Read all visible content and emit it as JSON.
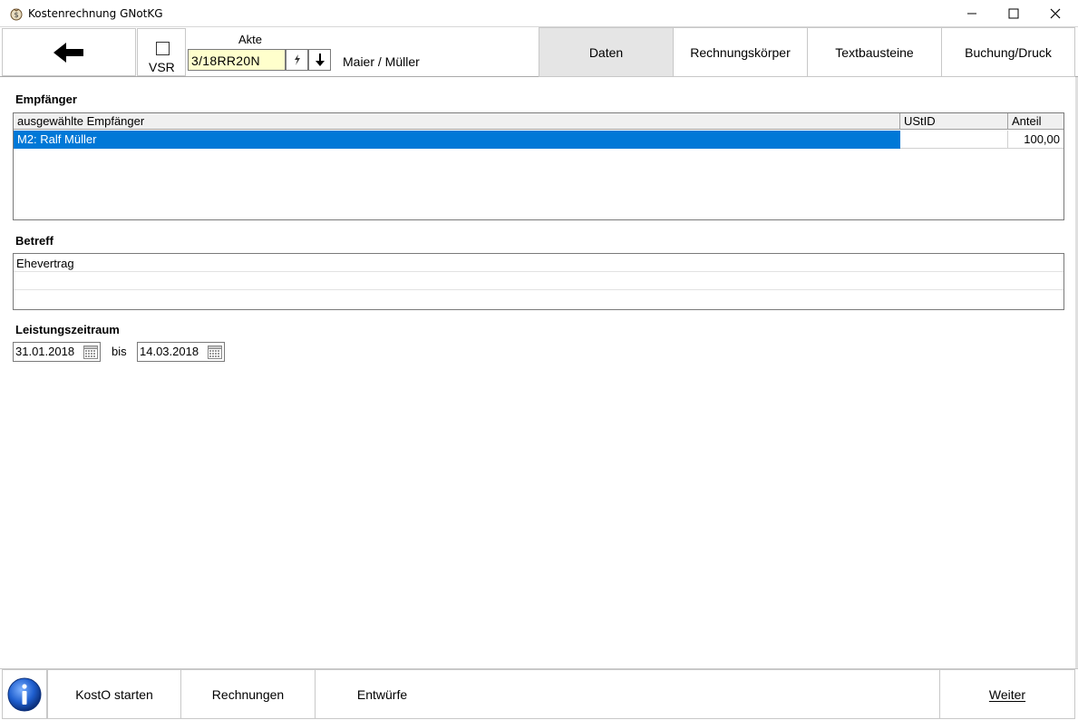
{
  "window": {
    "title": "Kostenrechnung GNotKG",
    "icon": "money-bag-icon"
  },
  "toolbar": {
    "back_icon": "arrow-left-icon",
    "vsr_label": "VSR",
    "vsr_checked": false,
    "akte_label": "Akte",
    "akte_value": "3/18RR20N",
    "party_text": "Maier / Müller",
    "tabs": [
      {
        "label": "Daten",
        "active": true
      },
      {
        "label": "Rechnungskörper",
        "active": false
      },
      {
        "label": "Textbausteine",
        "active": false
      },
      {
        "label": "Buchung/Druck",
        "active": false
      }
    ]
  },
  "empfaenger": {
    "label": "Empfänger",
    "columns": [
      "ausgewählte Empfänger",
      "UStID",
      "Anteil"
    ],
    "rows": [
      {
        "name": "M2: Ralf Müller",
        "ustid": "",
        "anteil": "100,00"
      }
    ]
  },
  "betreff": {
    "label": "Betreff",
    "lines": [
      "Ehevertrag",
      "",
      ""
    ]
  },
  "leistungszeitraum": {
    "label": "Leistungszeitraum",
    "from": "31.01.2018",
    "separator": "bis",
    "to": "14.03.2018"
  },
  "bottom": {
    "info_icon": "info-icon",
    "buttons": [
      "KostO starten",
      "Rechnungen",
      "Entwürfe"
    ],
    "weiter_label": "Weiter"
  },
  "colors": {
    "selection": "#0078d7",
    "akte_field": "#ffffcc",
    "active_tab": "#e5e5e5"
  }
}
